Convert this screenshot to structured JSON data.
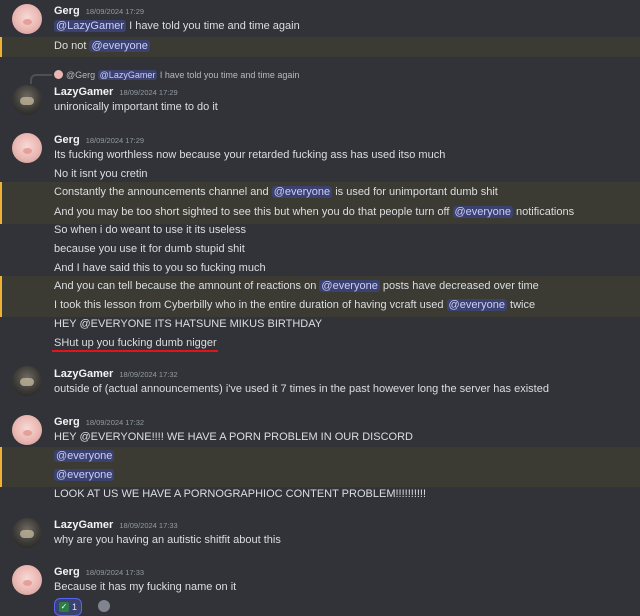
{
  "messages": [
    {
      "author": "Gerg",
      "timestamp": "18/09/2024 17:29",
      "lines": [
        {
          "mention": "@LazyGamer",
          "text": " I have told you time and time again"
        },
        {
          "prefix": "Do not ",
          "mention": "@everyone"
        }
      ]
    },
    {
      "reply": {
        "author": "@Gerg",
        "mention": "@LazyGamer",
        "text": " I have told you time and time again"
      },
      "author": "LazyGamer",
      "timestamp": "18/09/2024 17:29",
      "lines": [
        {
          "text": "unironically important time to do it"
        }
      ]
    },
    {
      "author": "Gerg",
      "timestamp": "18/09/2024 17:29",
      "lines": [
        {
          "text": "Its fucking worthless now because your retarded fucking ass has used itso much"
        },
        {
          "text": "No it isnt you cretin"
        },
        {
          "prefix": "Constantly the announcements channel and ",
          "mention": "@everyone",
          "text": " is used for unimportant dumb shit"
        },
        {
          "prefix": "And you may be too short sighted to see this but when you do that people turn off ",
          "mention": "@everyone",
          "text": " notifications"
        },
        {
          "text": "So when i do weant to use it its useless"
        },
        {
          "text": "because you use it for dumb stupid shit"
        },
        {
          "text": "And I have said this to you so fucking much"
        },
        {
          "prefix": "And you can tell because the amnount of reactions on ",
          "mention": "@everyone",
          "text": " posts have decreased over time"
        },
        {
          "prefix": "I took this lesson from Cyberbilly who in the entire duration of having vcraft used ",
          "mention": "@everyone",
          "text": " twice"
        },
        {
          "text": "HEY @EVERYONE ITS HATSUNE MIKUS BIRTHDAY"
        },
        {
          "text": "SHut up you fucking dumb nigger"
        }
      ]
    },
    {
      "author": "LazyGamer",
      "timestamp": "18/09/2024 17:32",
      "lines": [
        {
          "text": "outside of (actual announcements) i've used it 7 times in the past however long the server has existed"
        }
      ]
    },
    {
      "author": "Gerg",
      "timestamp": "18/09/2024 17:32",
      "lines": [
        {
          "text": "HEY @EVERYONE!!!! WE HAVE A PORN PROBLEM IN OUR DISCORD"
        },
        {
          "mention": "@everyone"
        },
        {
          "mention": "@everyone"
        },
        {
          "text": "LOOK AT US WE HAVE A PORNOGRAPHIOC CONTENT PROBLEM!!!!!!!!!!"
        }
      ]
    },
    {
      "author": "LazyGamer",
      "timestamp": "18/09/2024 17:33",
      "lines": [
        {
          "text": "why are you having an autistic shitfit about this"
        }
      ]
    },
    {
      "author": "Gerg",
      "timestamp": "18/09/2024 17:33",
      "lines": [
        {
          "text": "Because it has my fucking name on it"
        }
      ],
      "reaction": {
        "emoji": "✓",
        "count": "1"
      }
    }
  ],
  "colors": {
    "highlight_bar": "#f0b232",
    "mention_bg": "#3c4270",
    "underline": "#e0151b"
  }
}
